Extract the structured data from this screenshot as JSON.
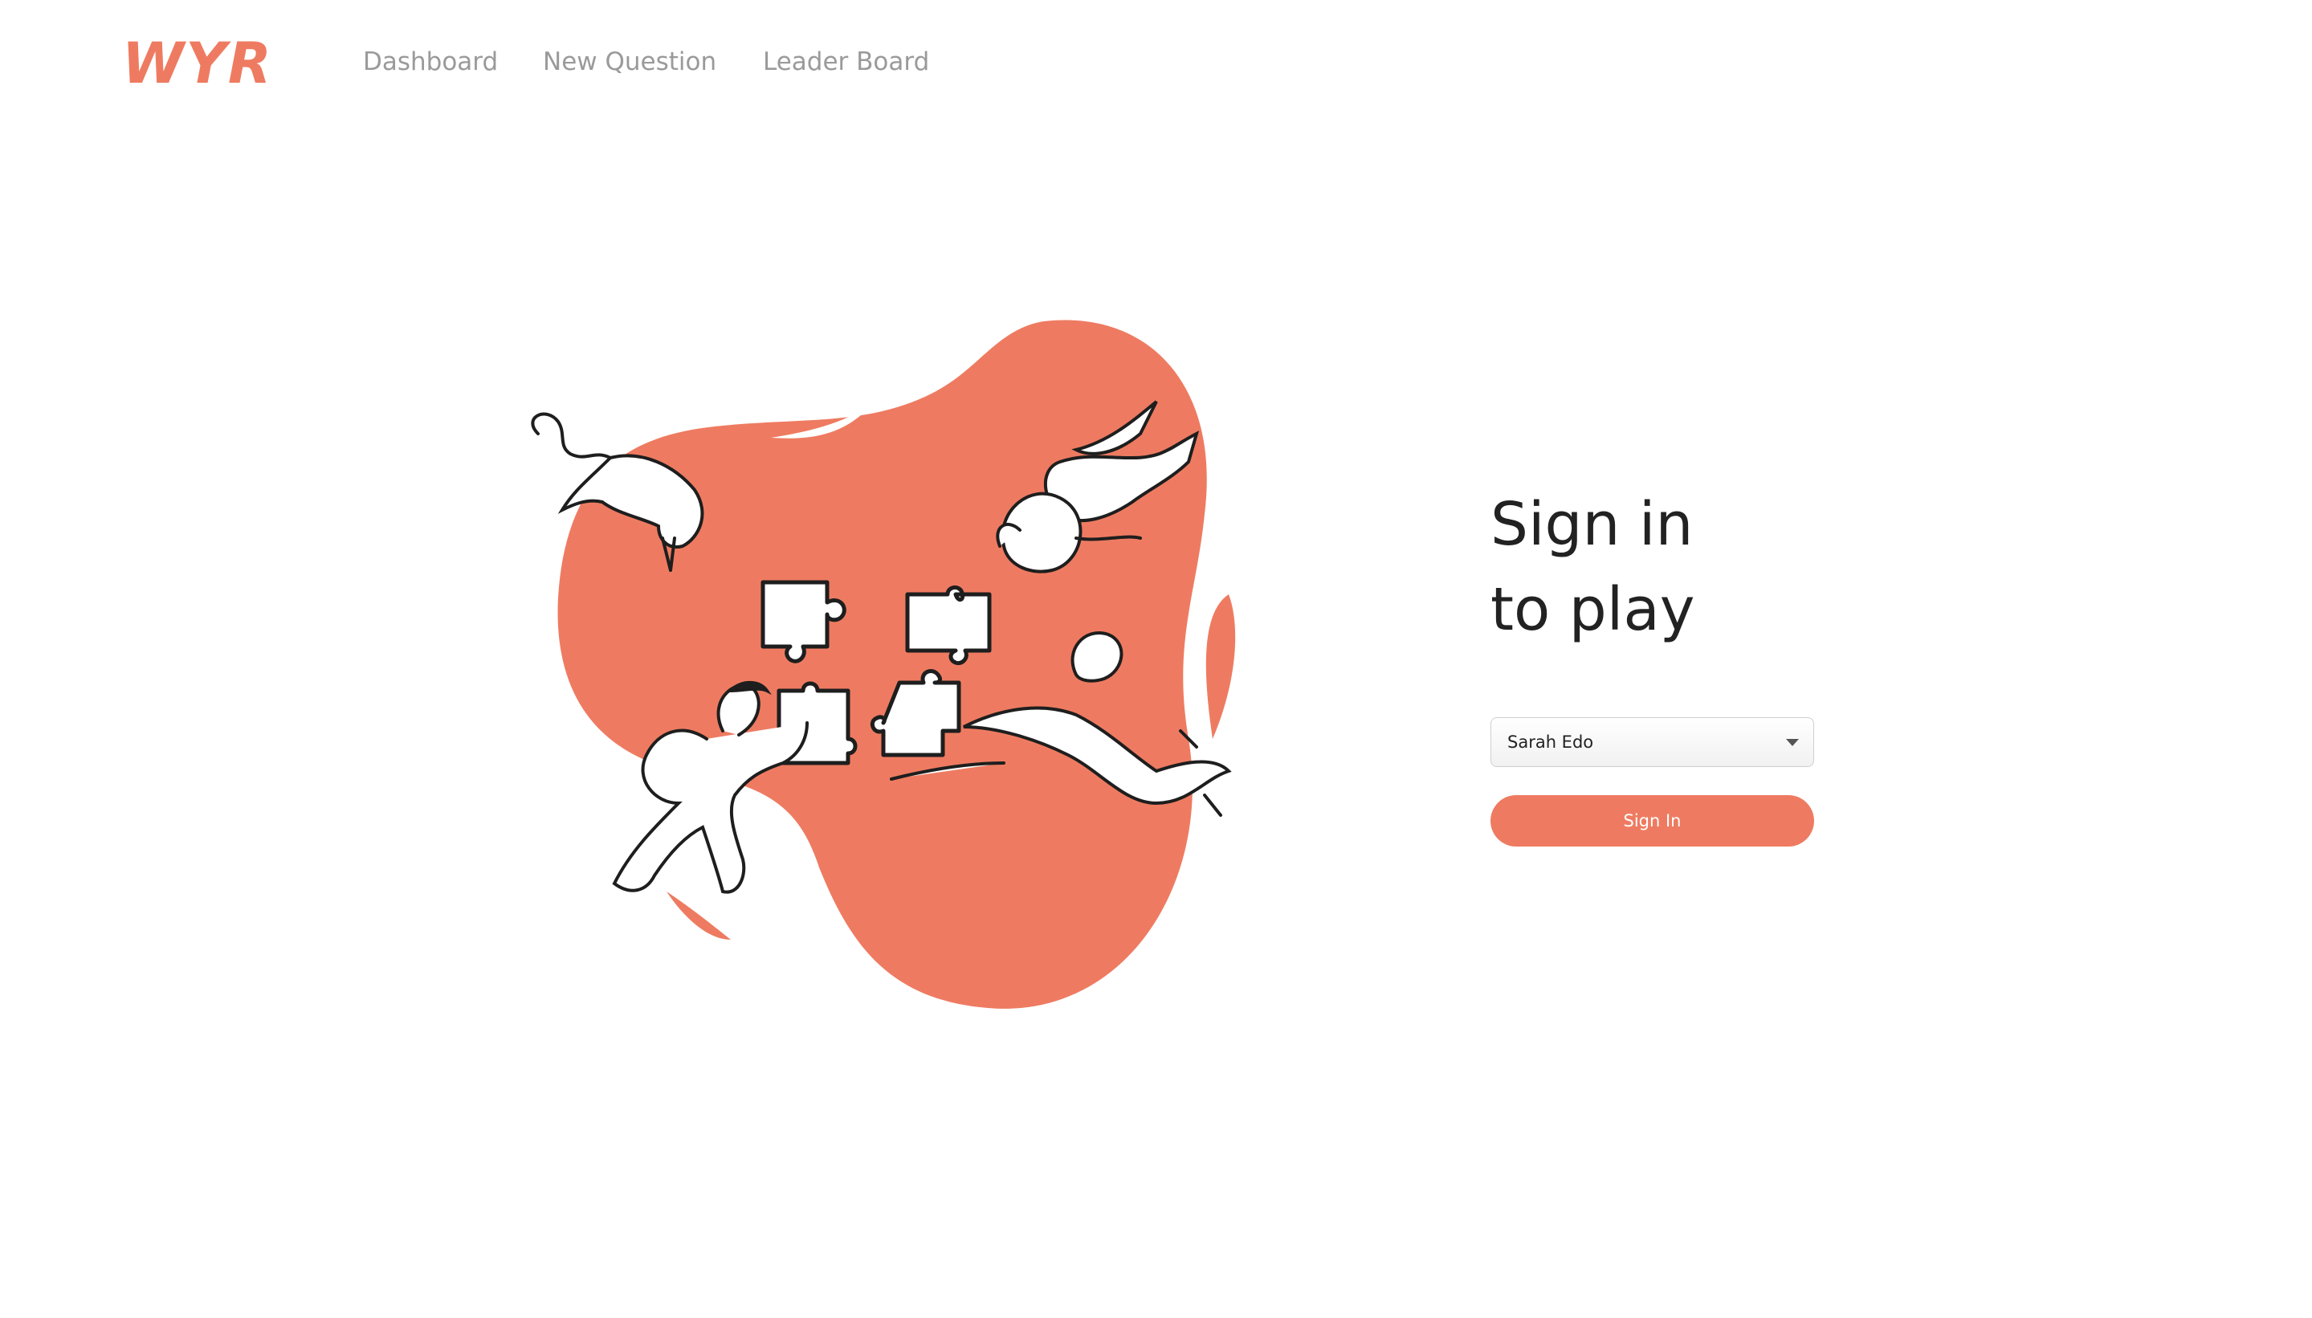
{
  "brand": {
    "logo_text": "WYR",
    "accent_color": "#ee7b61"
  },
  "nav": {
    "items": [
      {
        "label": "Dashboard"
      },
      {
        "label": "New Question"
      },
      {
        "label": "Leader Board"
      }
    ]
  },
  "signin": {
    "title_line1": "Sign in",
    "title_line2": "to play",
    "selected_user": "Sarah Edo",
    "button_label": "Sign In"
  },
  "illustration": {
    "icon": "puzzle-team-illustration"
  }
}
